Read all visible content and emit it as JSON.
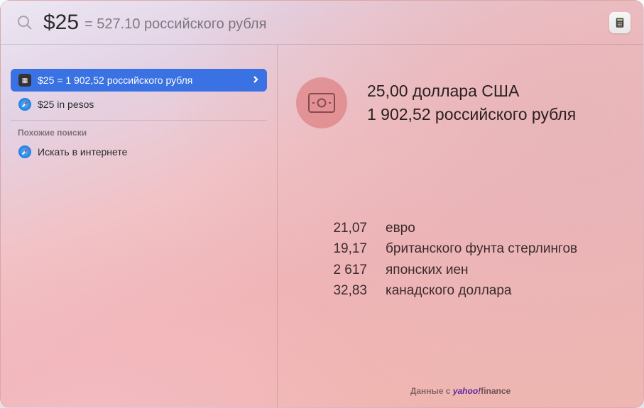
{
  "search": {
    "query": "$25",
    "inline_result": "= 527.10 российского рубля"
  },
  "sidebar": {
    "results": [
      {
        "label": "$25 = 1 902,52 российского рубля",
        "icon": "calculator",
        "selected": true
      },
      {
        "label": "$25 in pesos",
        "icon": "safari",
        "selected": false
      }
    ],
    "section_header": "Похожие поиски",
    "related": [
      {
        "label": "Искать в интернете",
        "icon": "safari"
      }
    ]
  },
  "detail": {
    "primary_amount": "25,00 доллара США",
    "converted_amount": "1 902,52 российского рубля",
    "other_rates": [
      {
        "value": "21,07",
        "label": "евро"
      },
      {
        "value": "19,17",
        "label": "британского фунта стерлингов"
      },
      {
        "value": "2 617",
        "label": "японских иен"
      },
      {
        "value": "32,83",
        "label": "канадского доллара"
      }
    ],
    "attribution_prefix": "Данные с ",
    "attribution_brand": "yahoo!",
    "attribution_suffix": "finance"
  },
  "colors": {
    "selection": "#3a72e3",
    "hero_circle": "rgba(214,92,92,0.45)"
  }
}
